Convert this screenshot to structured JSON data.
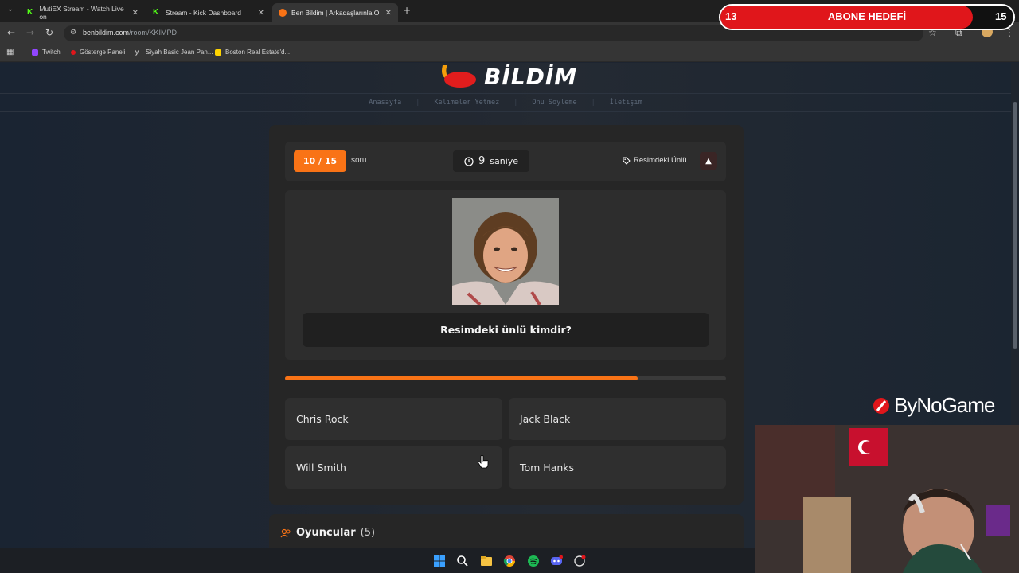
{
  "browser": {
    "tabs": [
      {
        "title": "MutiEX Stream - Watch Live on",
        "icon": "kick-icon",
        "color": "#53fc18"
      },
      {
        "title": "Stream - Kick Dashboard",
        "icon": "kick-icon",
        "color": "#53fc18"
      },
      {
        "title": "Ben Bildim | Arkadaşlarınla Onl",
        "icon": "benbildim-icon",
        "color": "#f97316"
      }
    ],
    "url_host": "benbildim.com",
    "url_path": "/room/KKIMPD",
    "bookmarks": [
      {
        "label": "Twitch",
        "color": "#9146ff"
      },
      {
        "label": "Gösterge Paneli",
        "color": "#e0161b"
      },
      {
        "label": "Siyah Basic Jean Pan...",
        "color": "#ffffff"
      },
      {
        "label": "Boston Real Estate'd...",
        "color": "#ffd400"
      }
    ]
  },
  "site": {
    "logo_text": "BİLDİM",
    "nav": [
      "Anasayfa",
      "Kelimeler Yetmez",
      "Onu Söyleme",
      "İletişim"
    ]
  },
  "quiz": {
    "question_counter": "10 / 15",
    "question_counter_label": "soru",
    "timer_value": "9",
    "timer_unit": "saniye",
    "category": "Resimdeki Ünlü",
    "question": "Resimdeki ünlü kimdir?",
    "time_progress": 0.8,
    "options": [
      "Chris Rock",
      "Jack Black",
      "Will Smith",
      "Tom Hanks"
    ]
  },
  "players": {
    "title": "Oyuncular",
    "count": "(5)"
  },
  "overlay": {
    "goal_title": "ABONE HEDEFİ",
    "goal_current": "13",
    "goal_target": "15",
    "goal_progress": 0.8667,
    "sponsor": "ByNoGame"
  },
  "colors": {
    "accent": "#f97316",
    "card": "#262626",
    "goal_red": "#e0161b"
  }
}
